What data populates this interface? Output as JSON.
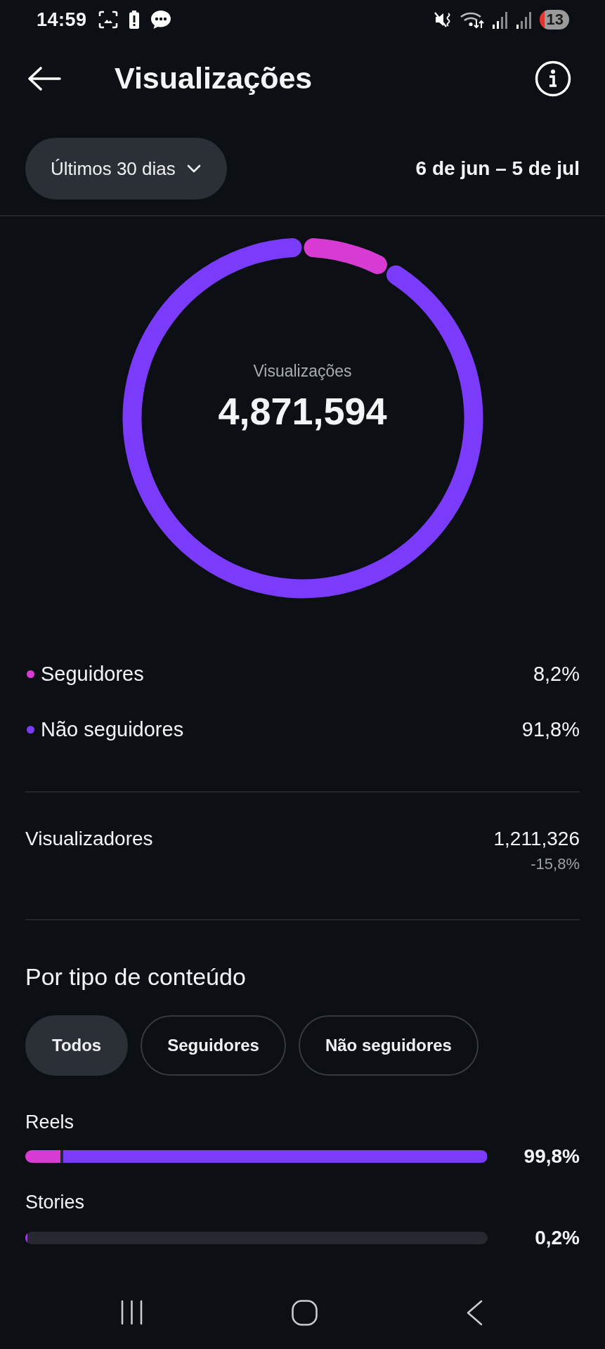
{
  "status_bar": {
    "time": "14:59",
    "battery": "13"
  },
  "header": {
    "title": "Visualizações"
  },
  "period": {
    "selector": "Últimos 30 dias",
    "range": "6 de jun – 5 de jul"
  },
  "donut": {
    "label": "Visualizações",
    "total": "4,871,594",
    "chart_data": {
      "type": "donut",
      "categories": [
        "Seguidores",
        "Não seguidores"
      ],
      "values": [
        8.2,
        91.8
      ]
    }
  },
  "legend": [
    {
      "value": "8,2%",
      "color": "#d83bd2"
    },
    {
      "value": "91,8%",
      "color": "#7b3bfa"
    }
  ],
  "viewers": {
    "label": "Visualizadores",
    "value": "1,211,326",
    "change": "-15,8%"
  },
  "content_types": {
    "title": "Por tipo de conteúdo",
    "filters": [
      {
        "label": "Todos",
        "selected": true
      },
      {
        "label": "Seguidores",
        "selected": false
      },
      {
        "label": "Não seguidores",
        "selected": false
      }
    ],
    "items": [
      {
        "label": "Reels",
        "value": "99,8%",
        "segments": [
          {
            "color": "#d83bd2",
            "level": 0.082
          },
          {
            "color": "#7b3bfa",
            "level": 0.916
          }
        ]
      },
      {
        "label": "Stories",
        "value": "0,2%",
        "segments": [
          {
            "color": "#a23be8",
            "level": 0.002
          }
        ]
      }
    ]
  }
}
